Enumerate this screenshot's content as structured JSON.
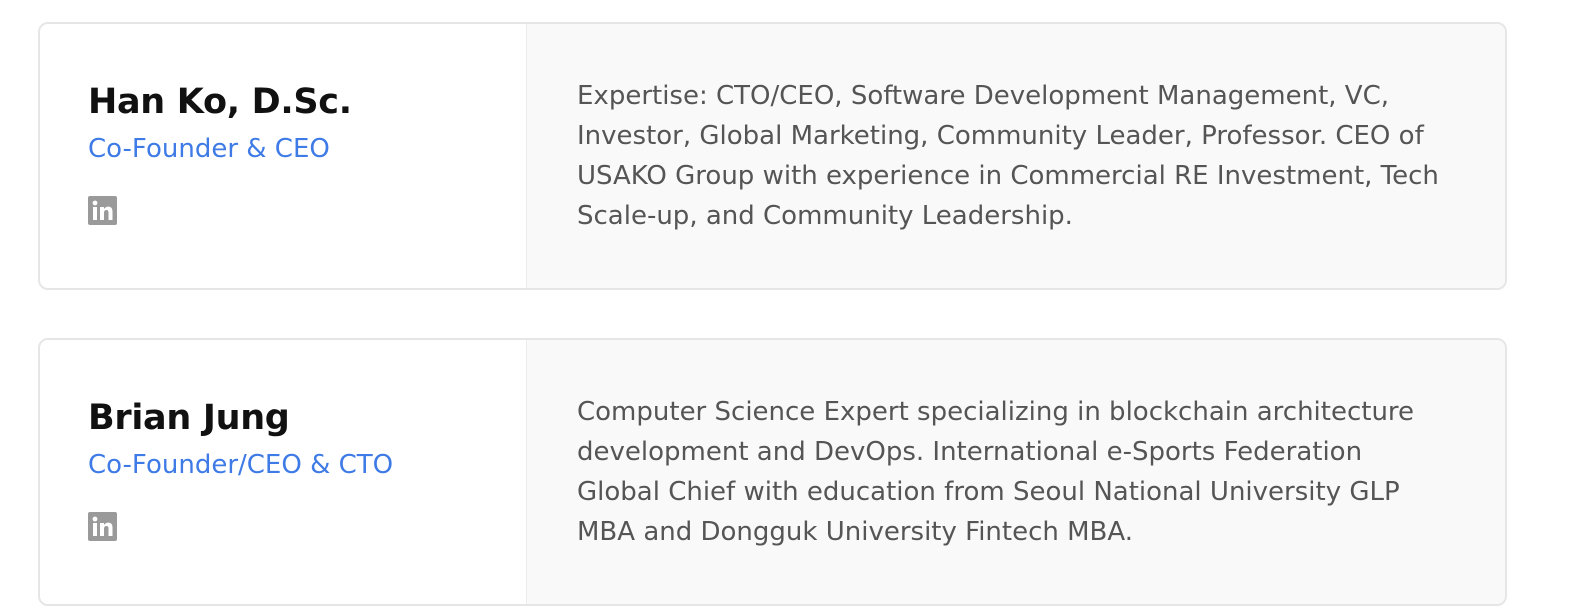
{
  "team": [
    {
      "name": "Han Ko, D.Sc.",
      "role": "Co-Founder & CEO",
      "social_icon": "linkedin-icon",
      "bio": "Expertise: CTO/CEO, Software Development Management, VC, Investor, Global Marketing, Community Leader, Professor. CEO of USAKO Group with experience in Commercial RE Investment, Tech Scale-up, and Community Leadership."
    },
    {
      "name": "Brian Jung",
      "role": "Co-Founder/CEO & CTO",
      "social_icon": "linkedin-icon",
      "bio": "Computer Science Expert specializing in blockchain architecture development and DevOps. International e-Sports Federation Global Chief with education from Seoul National University GLP MBA and Dongguk University Fintech MBA."
    }
  ],
  "colors": {
    "accent": "#3f7be6",
    "name_text": "#111111",
    "bio_text": "#555555",
    "bio_background": "#f9f9f9",
    "card_border": "#e6e6e6",
    "icon": "#9a9a9a"
  }
}
